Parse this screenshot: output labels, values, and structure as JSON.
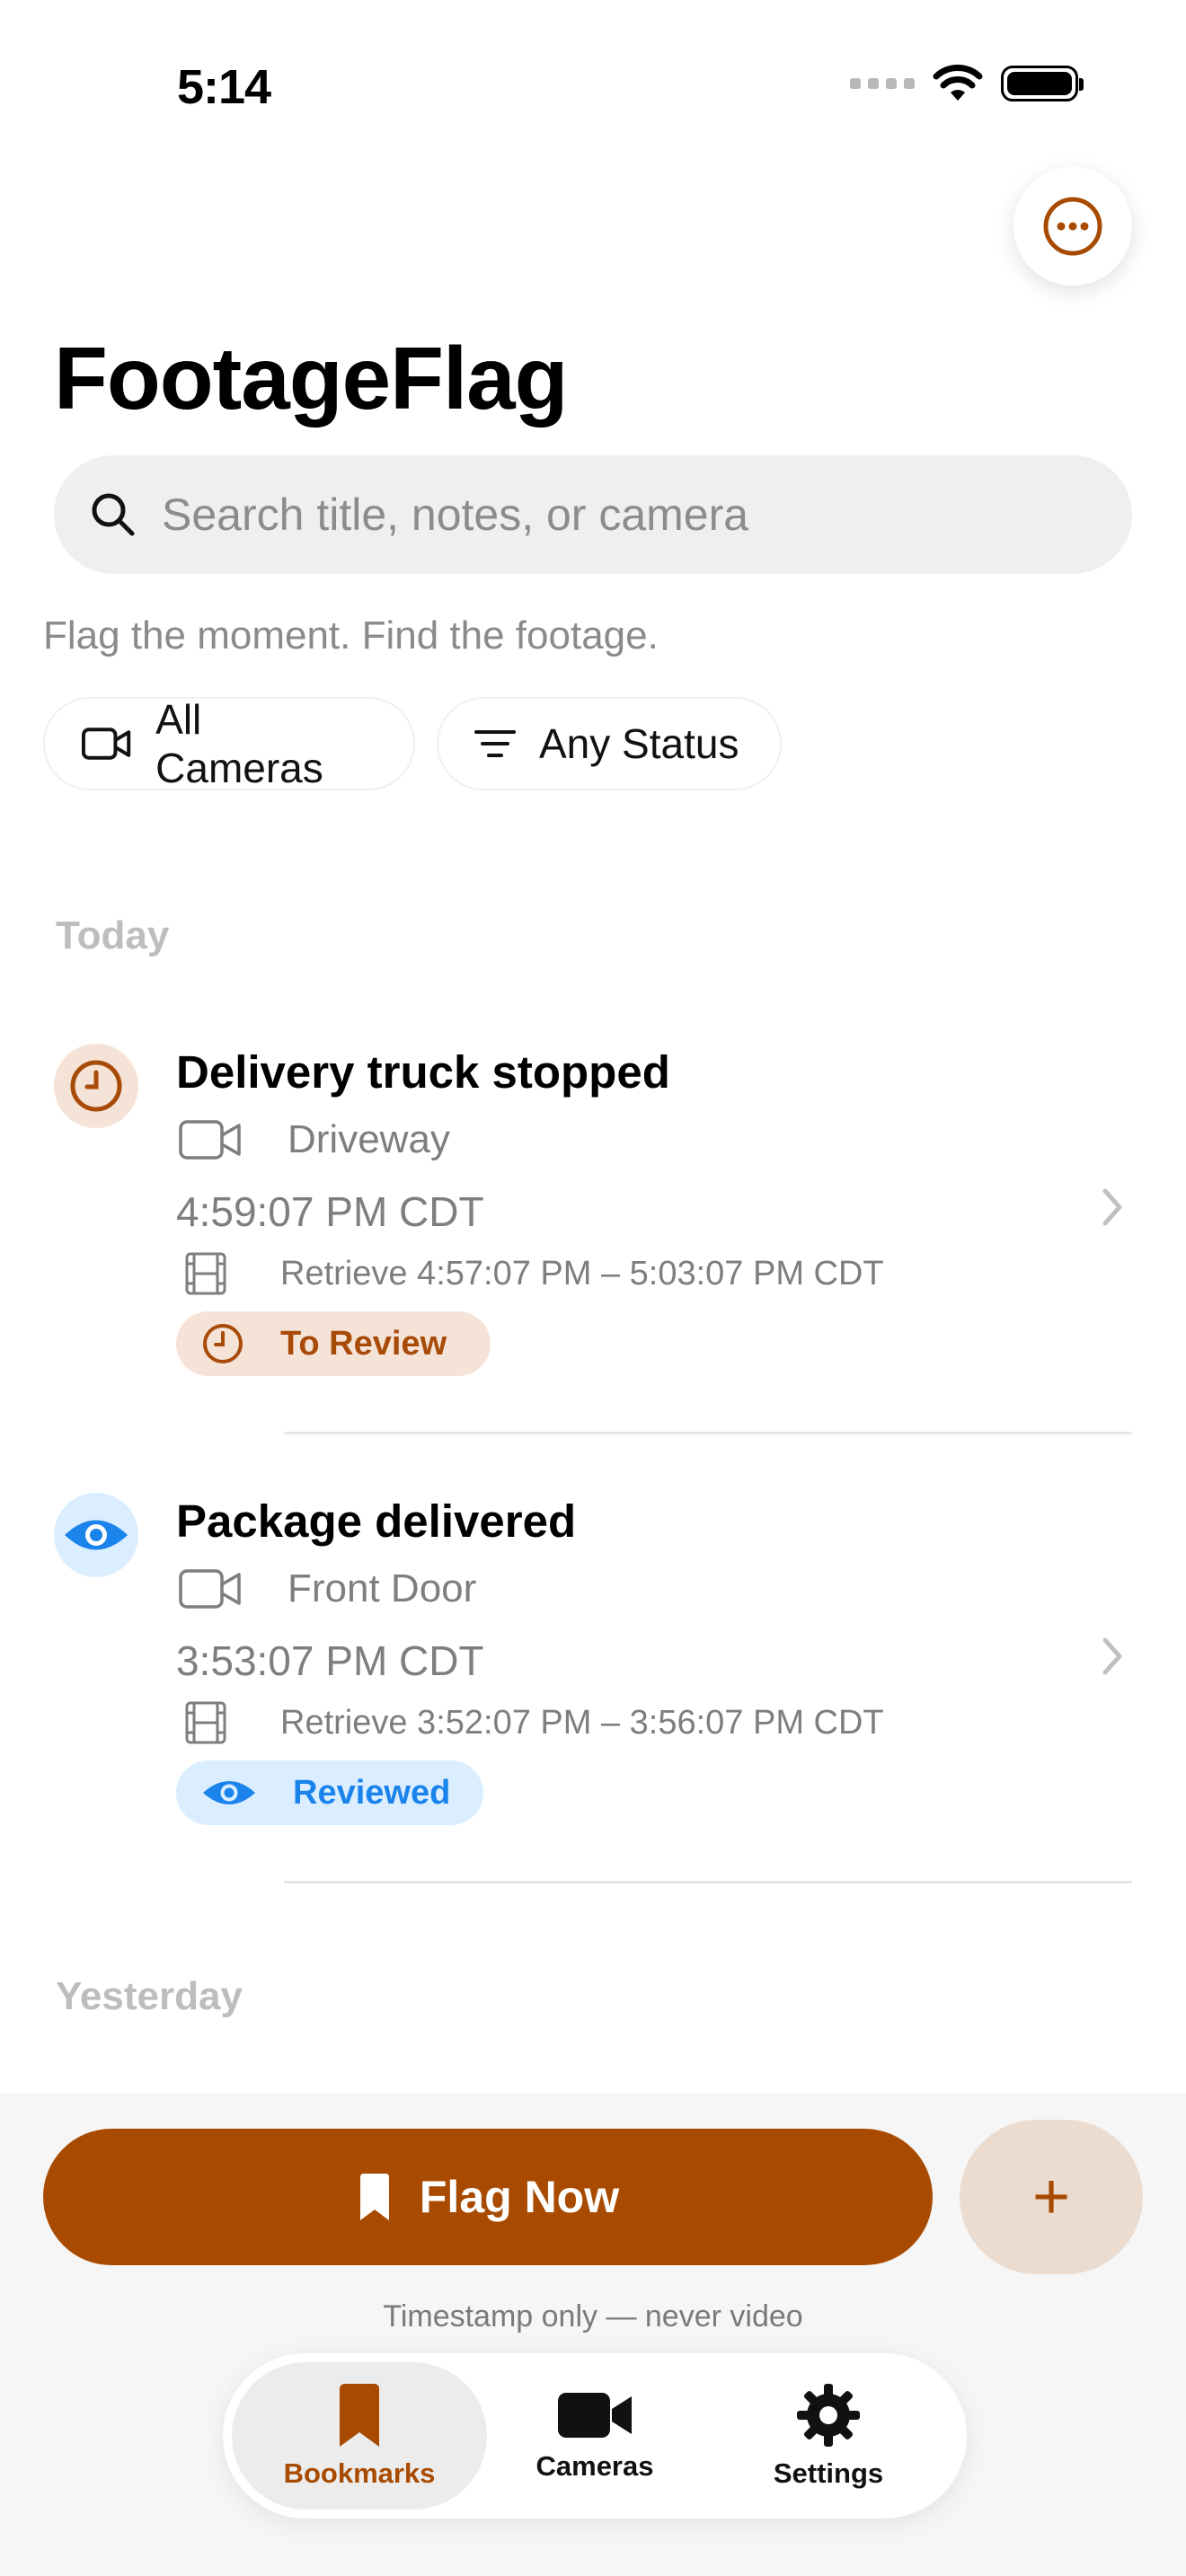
{
  "status_bar": {
    "time": "5:14"
  },
  "header": {
    "title": "FootageFlag"
  },
  "search": {
    "placeholder": "Search title, notes, or camera"
  },
  "tagline": "Flag the moment. Find the footage.",
  "filters": {
    "camera_label": "All Cameras",
    "status_label": "Any Status"
  },
  "sections": [
    {
      "label": "Today"
    },
    {
      "label": "Yesterday"
    }
  ],
  "bookmarks": [
    {
      "title": "Delivery truck stopped",
      "camera": "Driveway",
      "time": "4:59:07 PM CDT",
      "retrieve": "Retrieve 4:57:07 PM – 5:03:07 PM CDT",
      "status": "To Review",
      "icon": "clock-icon",
      "color": "#a84b08"
    },
    {
      "title": "Package delivered",
      "camera": "Front Door",
      "time": "3:53:07 PM CDT",
      "retrieve": "Retrieve 3:52:07 PM – 3:56:07 PM CDT",
      "status": "Reviewed",
      "icon": "eye-icon",
      "color": "#1a84ec"
    }
  ],
  "actions": {
    "flag_label": "Flag Now",
    "add_label": "+",
    "note": "Timestamp only — never video"
  },
  "tabs": [
    {
      "label": "Bookmarks",
      "active": true
    },
    {
      "label": "Cameras",
      "active": false
    },
    {
      "label": "Settings",
      "active": false
    }
  ],
  "colors": {
    "accent": "#a84b00",
    "review_bg": "#f4e3d6",
    "reviewed_blue": "#1a84ec",
    "reviewed_bg": "#dbeeff"
  }
}
